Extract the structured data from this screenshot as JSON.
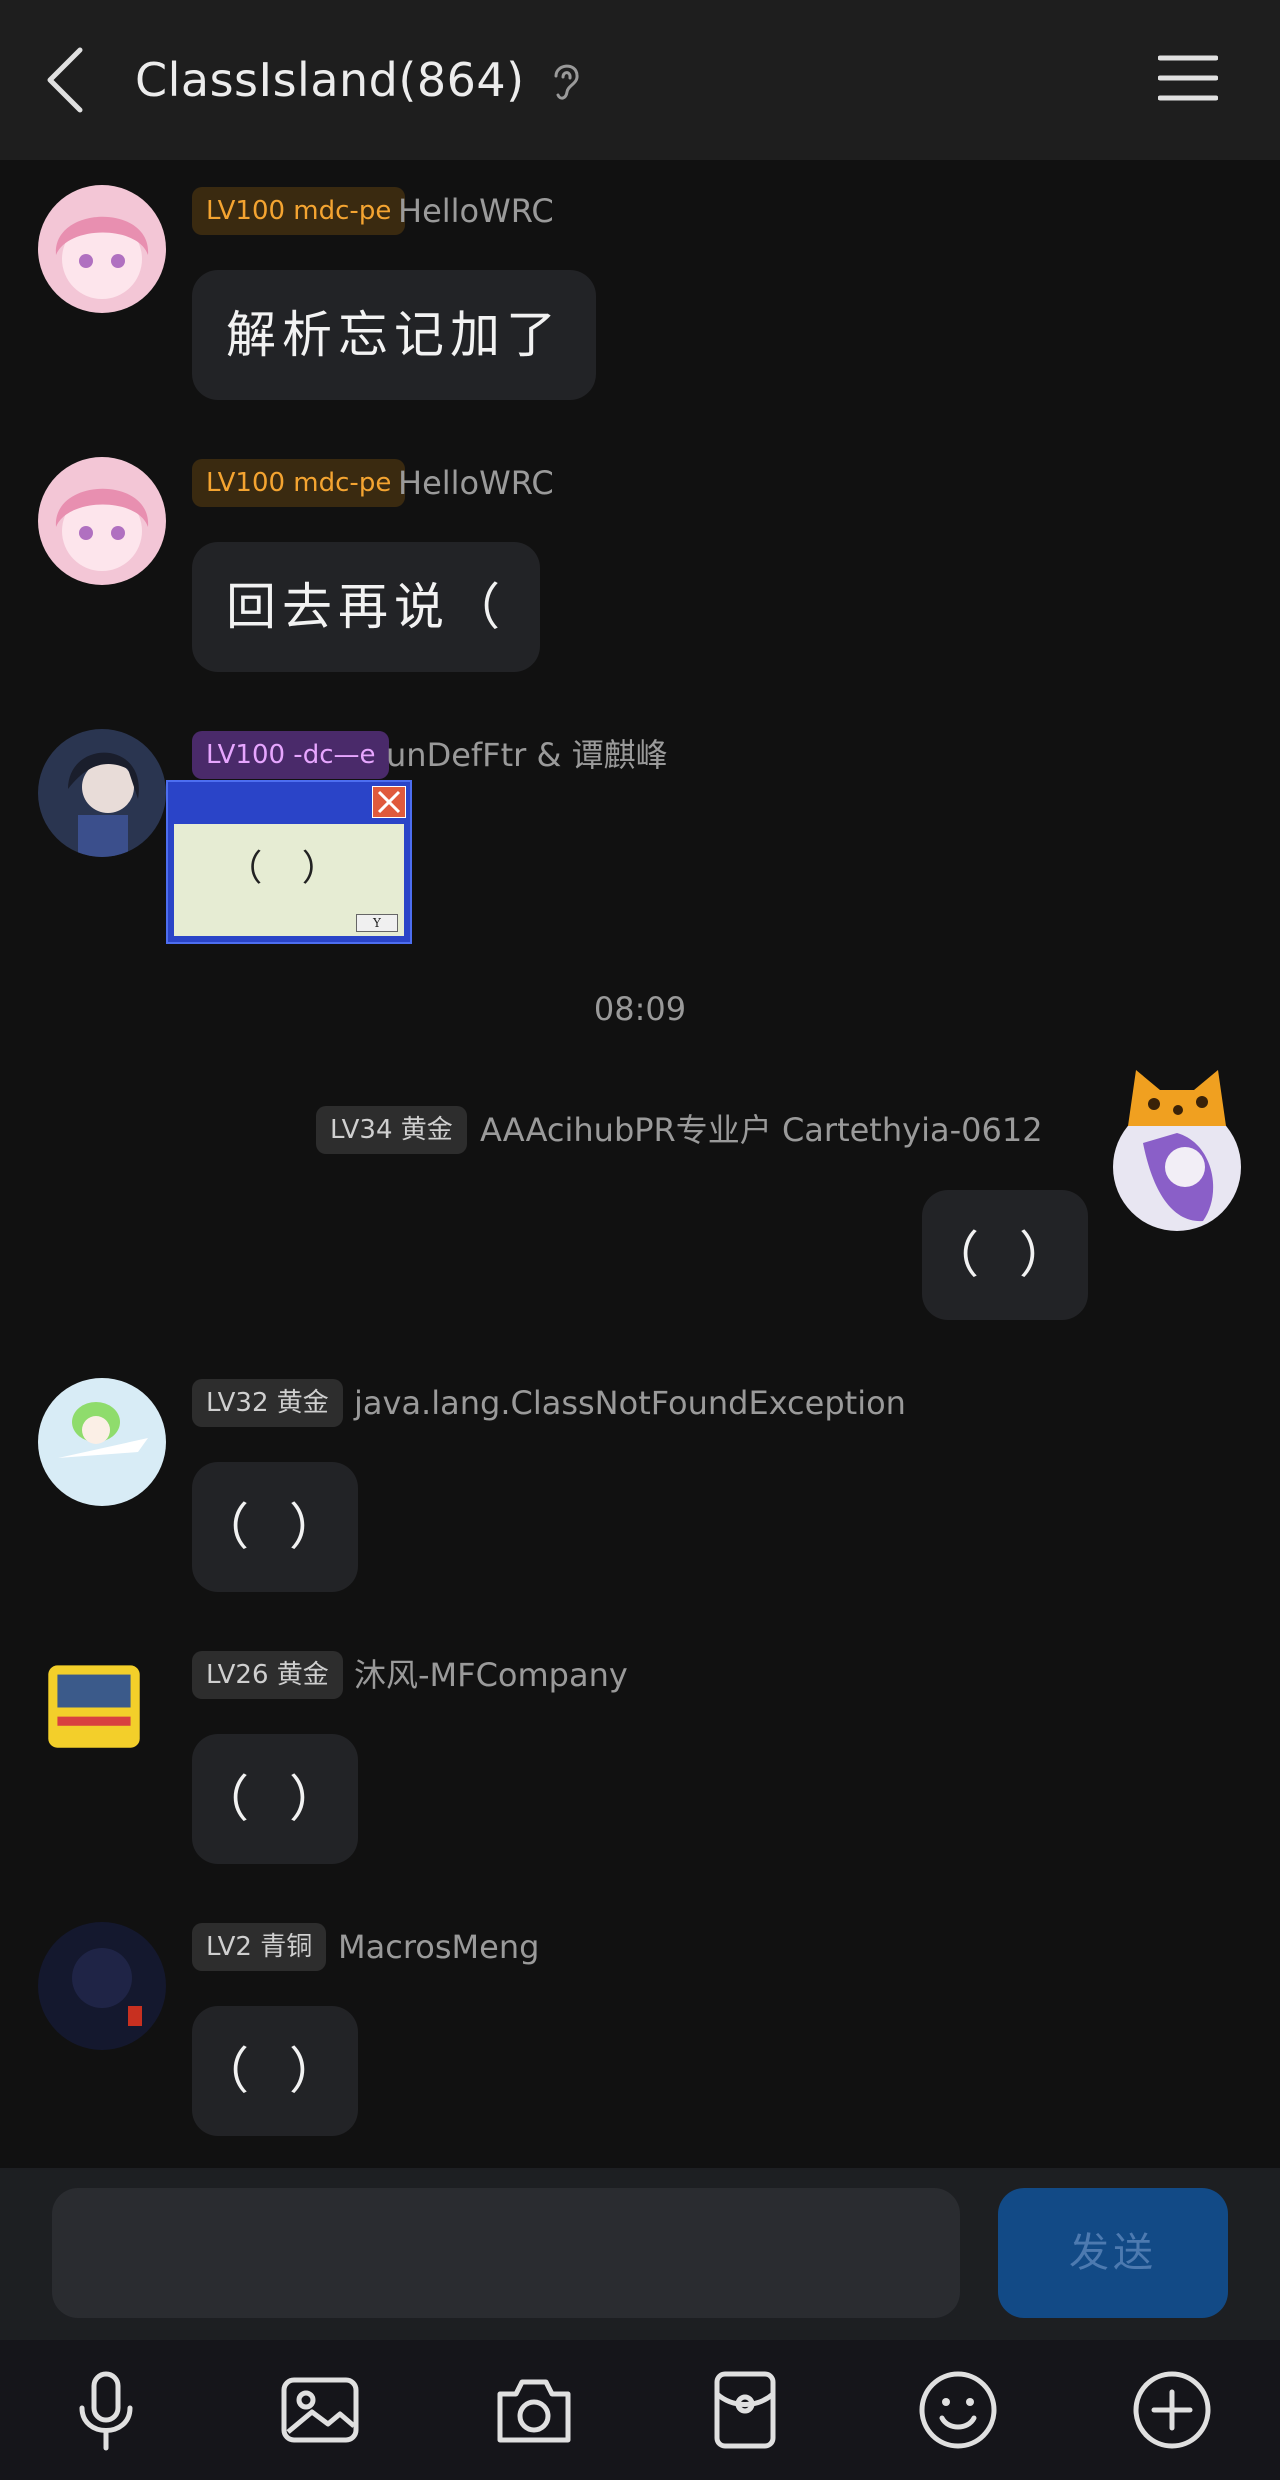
{
  "header": {
    "title": "ClassIsland(864)"
  },
  "messages": [
    {
      "level": "LV100 mdc-pe",
      "sender": "HelloWRC",
      "text": "解析忘记加了"
    },
    {
      "level": "LV100 mdc-pe",
      "sender": "HelloWRC",
      "text": "回去再说（"
    },
    {
      "level": "LV100 -dc—e",
      "sender": "unDefFtr & 谭麒峰",
      "sticker_text": "（ ）",
      "sticker_button": "Y"
    },
    {
      "level": "LV34 黄金",
      "sender": "AAAcihubPR专业户 Cartethyia-0612",
      "text": "（ ）"
    },
    {
      "level": "LV32 黄金",
      "sender": "java.lang.ClassNotFoundException",
      "text": "（ ）"
    },
    {
      "level": "LV26 黄金",
      "sender": "沐风-MFCompany",
      "text": "（ ）"
    },
    {
      "level": "LV2 青铜",
      "sender": "MacrosMeng",
      "text": "（ ）"
    }
  ],
  "timestamp": "08:09",
  "composer": {
    "input_value": "",
    "send_label": "发送"
  },
  "toolbar": [
    "microphone-icon",
    "image-icon",
    "camera-icon",
    "red-packet-icon",
    "emoji-icon",
    "plus-icon"
  ],
  "colors": {
    "background": "#111111",
    "bubble": "#222326",
    "send": "#124a86",
    "badge_orange": "#f4a431",
    "badge_purple": "#e7a6ff"
  }
}
